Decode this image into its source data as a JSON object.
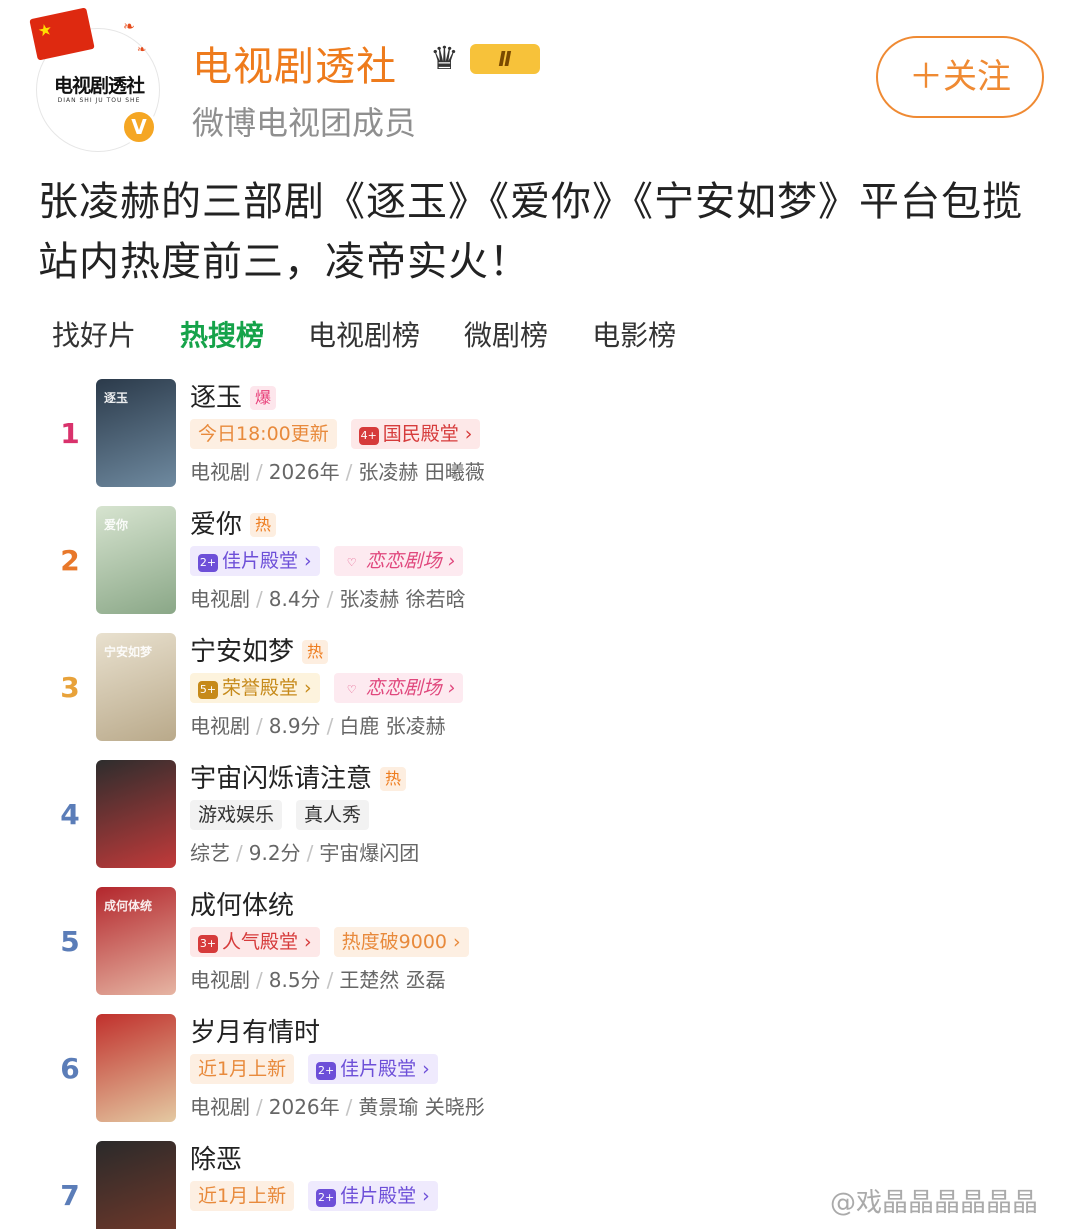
{
  "header": {
    "username": "电视剧透社",
    "level": "Ⅱ",
    "subtitle": "微博电视团成员",
    "follow_label": "＋关注",
    "avatar_text": "电视剧透社",
    "avatar_sub": "DIAN SHI JU TOU SHE",
    "verify_mark": "V"
  },
  "post": {
    "text": "张凌赫的三部剧《逐玉》《爱你》《宁安如梦》平台包揽站内热度前三，凌帝实火！"
  },
  "tabs": [
    "找好片",
    "热搜榜",
    "电视剧榜",
    "微剧榜",
    "电影榜"
  ],
  "ranking": [
    {
      "rank": "1",
      "rank_color": "#d9326c",
      "title": "逐玉",
      "heat": "爆",
      "tags": [
        {
          "label": "今日18:00更新",
          "style": "orange"
        },
        {
          "label": "国民殿堂 ›",
          "style": "red",
          "icon": "4+"
        }
      ],
      "meta": [
        "电视剧",
        "2026年",
        "张凌赫 田曦薇"
      ],
      "poster_colors": [
        "#2b3a4a",
        "#6f8aa0"
      ],
      "poster_text": "逐玉"
    },
    {
      "rank": "2",
      "rank_color": "#e8782a",
      "title": "爱你",
      "heat": "热",
      "tags": [
        {
          "label": "佳片殿堂 ›",
          "style": "purple",
          "icon": "2+"
        },
        {
          "label": "恋恋剧场 ›",
          "style": "pink",
          "icon": "♡"
        }
      ],
      "meta": [
        "电视剧",
        "8.4分",
        "张凌赫 徐若晗"
      ],
      "poster_colors": [
        "#d7e4d0",
        "#8aa787"
      ],
      "poster_text": "爱你"
    },
    {
      "rank": "3",
      "rank_color": "#e8a23a",
      "title": "宁安如梦",
      "heat": "热",
      "tags": [
        {
          "label": "荣誉殿堂 ›",
          "style": "gold",
          "icon": "5+"
        },
        {
          "label": "恋恋剧场 ›",
          "style": "pink",
          "icon": "♡"
        }
      ],
      "meta": [
        "电视剧",
        "8.9分",
        "白鹿 张凌赫"
      ],
      "poster_colors": [
        "#e9e1cf",
        "#b9a98a"
      ],
      "poster_text": "宁安如梦"
    },
    {
      "rank": "4",
      "rank_color": "#5b7db8",
      "title": "宇宙闪烁请注意",
      "heat": "热",
      "tags": [
        {
          "label": "游戏娱乐",
          "style": "grey"
        },
        {
          "label": "真人秀",
          "style": "grey"
        }
      ],
      "meta": [
        "综艺",
        "9.2分",
        "宇宙爆闪团"
      ],
      "poster_colors": [
        "#2d2d2d",
        "#c23a3a"
      ],
      "poster_text": ""
    },
    {
      "rank": "5",
      "rank_color": "#5b7db8",
      "title": "成何体统",
      "heat": "",
      "tags": [
        {
          "label": "人气殿堂 ›",
          "style": "red",
          "icon": "3+"
        },
        {
          "label": "热度破9000 ›",
          "style": "orange"
        }
      ],
      "meta": [
        "电视剧",
        "8.5分",
        "王楚然 丞磊"
      ],
      "poster_colors": [
        "#b3262c",
        "#e6b5a3"
      ],
      "poster_text": "成何体统"
    },
    {
      "rank": "6",
      "rank_color": "#5b7db8",
      "title": "岁月有情时",
      "heat": "",
      "tags": [
        {
          "label": "近1月上新",
          "style": "orange"
        },
        {
          "label": "佳片殿堂 ›",
          "style": "purple",
          "icon": "2+"
        }
      ],
      "meta": [
        "电视剧",
        "2026年",
        "黄景瑜 关晓彤"
      ],
      "poster_colors": [
        "#c0302c",
        "#e4c9a2"
      ],
      "poster_text": ""
    },
    {
      "rank": "7",
      "rank_color": "#5b7db8",
      "title": "除恶",
      "heat": "",
      "tags": [
        {
          "label": "近1月上新",
          "style": "orange"
        },
        {
          "label": "佳片殿堂 ›",
          "style": "purple",
          "icon": "2+"
        }
      ],
      "meta": [],
      "poster_colors": [
        "#2a2a2a",
        "#7a3a2a"
      ],
      "poster_text": ""
    }
  ],
  "watermarks": {
    "bottom": "@戏晶晶晶晶晶晶"
  }
}
